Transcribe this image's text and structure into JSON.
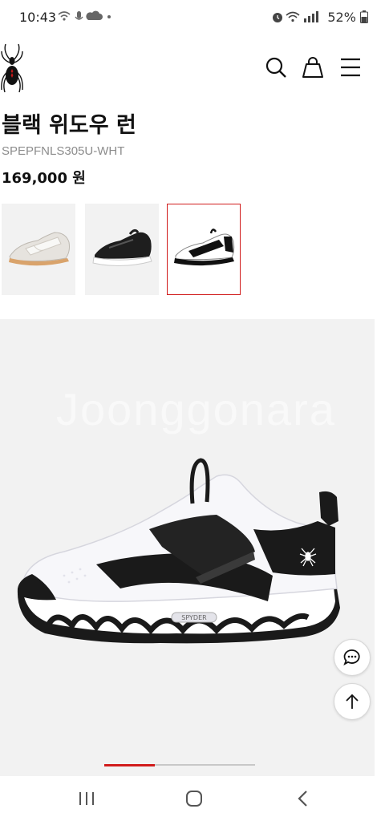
{
  "status": {
    "time": "10:43",
    "left_icons": [
      "wifi-icon",
      "mic-icon",
      "cloud-icon",
      "dot-icon"
    ],
    "battery": "52%",
    "right_icons": [
      "alarm-icon",
      "wifi-icon",
      "signal-icon",
      "battery-icon"
    ]
  },
  "header": {
    "icons": [
      "spider-logo-icon",
      "search-icon",
      "bag-icon",
      "menu-icon"
    ]
  },
  "product": {
    "name": "블랙 위도우 런",
    "sku": "SPEPFNLS305U-WHT",
    "price": "169,000 원"
  },
  "thumbnails": [
    {
      "name": "white-beige-shoe",
      "selected": false
    },
    {
      "name": "black-white-shoe",
      "selected": false
    },
    {
      "name": "white-black-shoe",
      "selected": true
    }
  ],
  "hero": {
    "watermark": "Joonggonara",
    "brand_text": "SPYDER"
  },
  "gallery": {
    "current_index": 1,
    "total": 3
  },
  "floating": [
    "chat-icon",
    "arrow-up-icon"
  ],
  "navbar": [
    "recent-apps-icon",
    "home-icon",
    "back-icon"
  ],
  "colors": {
    "accent": "#d11c1c",
    "hero_bg": "#f2f2f2",
    "sku_gray": "#8c8c8c"
  }
}
